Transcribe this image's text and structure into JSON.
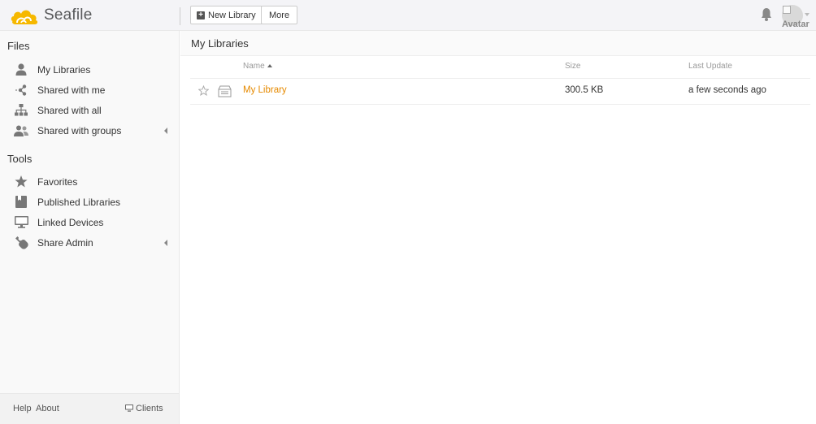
{
  "header": {
    "logo_text": "Seafile",
    "new_library_label": "New Library",
    "more_label": "More",
    "avatar_alt": "Avatar"
  },
  "sidebar": {
    "files_title": "Files",
    "files_items": [
      {
        "label": "My Libraries",
        "icon": "user-icon"
      },
      {
        "label": "Shared with me",
        "icon": "share-icon"
      },
      {
        "label": "Shared with all",
        "icon": "org-chart-icon"
      },
      {
        "label": "Shared with groups",
        "icon": "group-icon"
      }
    ],
    "tools_title": "Tools",
    "tools_items": [
      {
        "label": "Favorites",
        "icon": "star-icon"
      },
      {
        "label": "Published Libraries",
        "icon": "book-icon"
      },
      {
        "label": "Linked Devices",
        "icon": "monitor-icon"
      },
      {
        "label": "Share Admin",
        "icon": "wrench-icon"
      }
    ],
    "footer": {
      "help": "Help",
      "about": "About",
      "clients": "Clients"
    }
  },
  "main": {
    "title": "My Libraries",
    "columns": {
      "name": "Name",
      "size": "Size",
      "last_update": "Last Update"
    },
    "rows": [
      {
        "name": "My Library",
        "size": "300.5 KB",
        "last_update": "a few seconds ago"
      }
    ]
  },
  "colors": {
    "accent": "#e68a00",
    "logo_yellow": "#f6b800"
  }
}
